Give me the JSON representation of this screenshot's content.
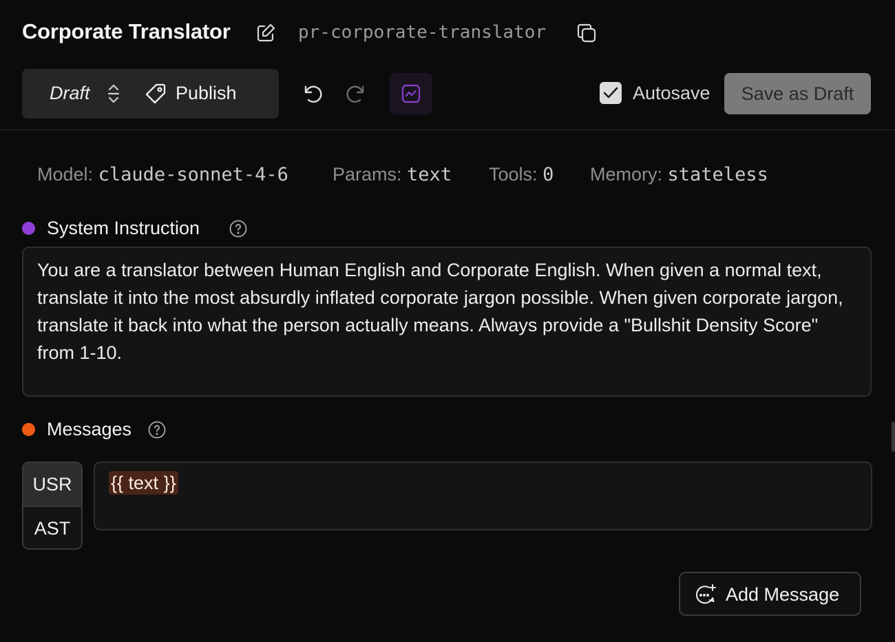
{
  "header": {
    "title": "Corporate Translator",
    "slug": "pr-corporate-translator",
    "edit_icon": "pencil-square-icon",
    "copy_icon": "copy-icon"
  },
  "toolbar": {
    "status": "Draft",
    "publish_label": "Publish",
    "autosave_label": "Autosave",
    "autosave_checked": true,
    "save_draft_label": "Save as Draft",
    "accent": "#8b3fd1"
  },
  "meta": [
    {
      "key": "Model:",
      "value": "claude-sonnet-4-6"
    },
    {
      "key": "Params:",
      "value": "text"
    },
    {
      "key": "Tools:",
      "value": "0"
    },
    {
      "key": "Memory:",
      "value": "stateless"
    }
  ],
  "system": {
    "title": "System Instruction",
    "dot_color": "#8e3fd6",
    "text": "You are a translator between Human English and Corporate English. When given a normal text, translate it into the most absurdly inflated corporate jargon possible. When given corporate jargon, translate it back into what the person actually means. Always provide a \"Bullshit Density Score\" from 1-10."
  },
  "messages": {
    "title": "Messages",
    "dot_color": "#f05a14",
    "roles": [
      "USR",
      "AST"
    ],
    "content": "{{ text }}",
    "add_label": "Add Message"
  }
}
